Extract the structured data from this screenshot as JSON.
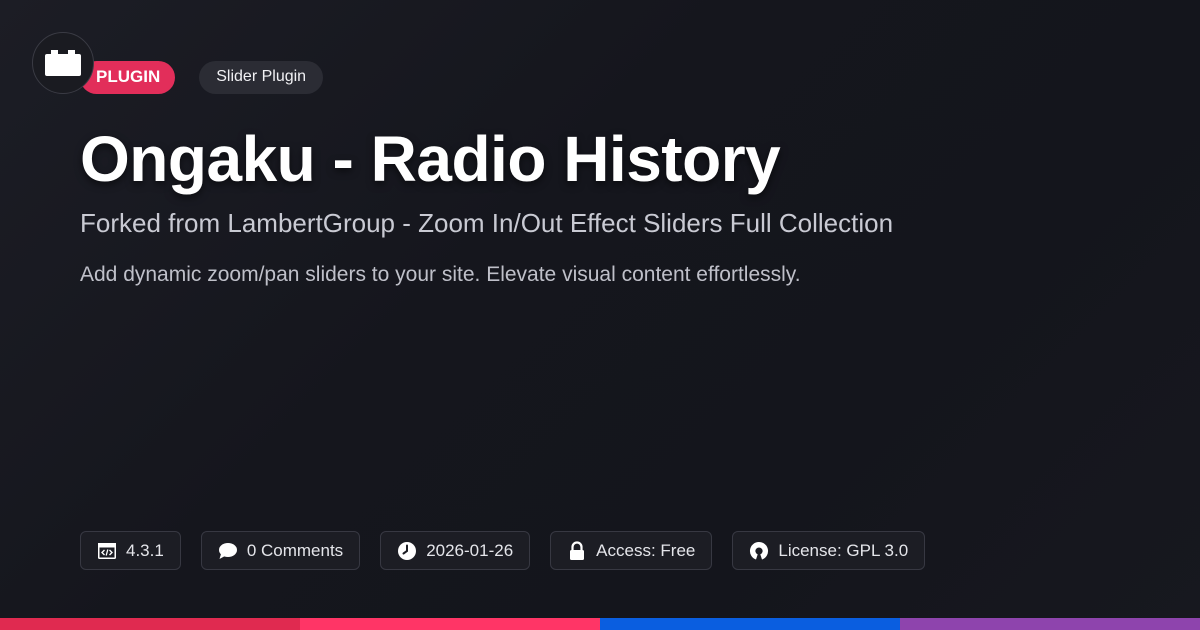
{
  "logo": {
    "icon": "plugin-block-icon"
  },
  "badges": {
    "type_label": "PLUGIN",
    "category_label": "Slider Plugin"
  },
  "title": "Ongaku - Radio History",
  "subtitle": "Forked from LambertGroup - Zoom In/Out Effect Sliders Full Collection",
  "description": "Add dynamic zoom/pan sliders to your site. Elevate visual content effortlessly.",
  "meta": [
    {
      "icon": "code-window-icon",
      "text": "4.3.1"
    },
    {
      "icon": "comment-bubble-icon",
      "text": "0 Comments"
    },
    {
      "icon": "clock-icon",
      "text": "2026-01-26"
    },
    {
      "icon": "lock-icon",
      "text": "Access: Free"
    },
    {
      "icon": "open-source-icon",
      "text": "License: GPL 3.0"
    }
  ],
  "colors": {
    "background": "#16171e",
    "accent_badge": "#e22e5a",
    "bar_1": "#e02a50",
    "bar_2": "#ff3566",
    "bar_3": "#0a5ee0",
    "bar_4": "#8e44ad"
  }
}
